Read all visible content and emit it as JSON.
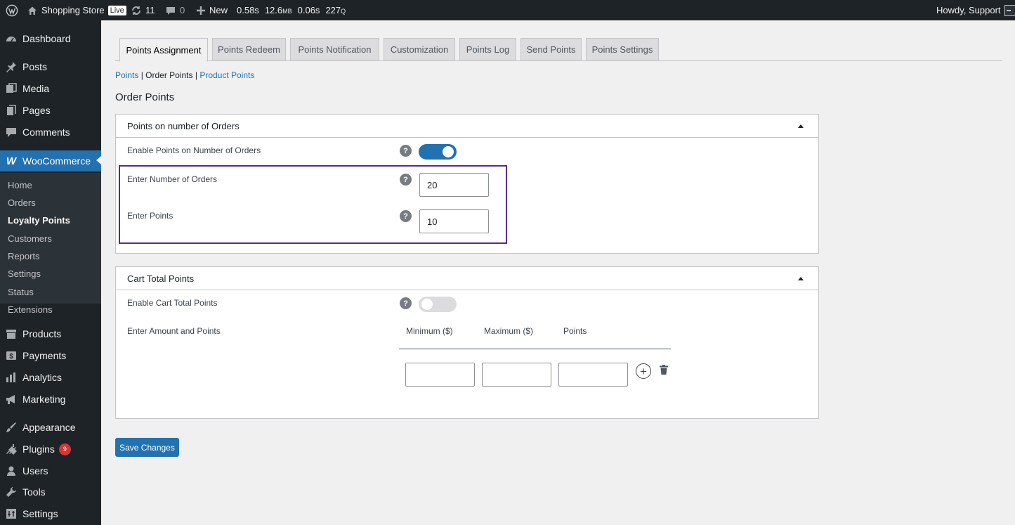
{
  "admin_bar": {
    "site_name": "Shopping Store",
    "live_badge": "Live",
    "updates_count": "11",
    "comments_count": "0",
    "new_label": "New",
    "perf_time": "0.58s",
    "perf_mem_value": "12.6",
    "perf_mem_unit": "MB",
    "perf_query_time": "0.06s",
    "perf_queries_value": "227",
    "perf_queries_unit": "Q",
    "greeting": "Howdy, Support"
  },
  "sidebar": {
    "dashboard": "Dashboard",
    "posts": "Posts",
    "media": "Media",
    "pages": "Pages",
    "comments": "Comments",
    "woocommerce": "WooCommerce",
    "submenu": [
      "Home",
      "Orders",
      "Loyalty Points",
      "Customers",
      "Reports",
      "Settings",
      "Status",
      "Extensions"
    ],
    "products": "Products",
    "payments": "Payments",
    "analytics": "Analytics",
    "marketing": "Marketing",
    "appearance": "Appearance",
    "plugins": "Plugins",
    "plugins_badge": "9",
    "users": "Users",
    "tools": "Tools",
    "settings": "Settings"
  },
  "tabs": [
    "Points Assignment",
    "Points Redeem",
    "Points Notification",
    "Customization",
    "Points Log",
    "Send Points",
    "Points Settings"
  ],
  "active_tab": "Points Assignment",
  "subnav": {
    "points": "Points",
    "sep1": " | ",
    "order_points": "Order Points",
    "sep2": " | ",
    "product_points": "Product Points"
  },
  "page_title": "Order Points",
  "orders_section": {
    "title": "Points on number of Orders",
    "enable_label": "Enable Points on Number of Orders",
    "enabled": true,
    "num_orders_label": "Enter Number of Orders",
    "num_orders_value": "20",
    "points_label": "Enter Points",
    "points_value": "10"
  },
  "cart_section": {
    "title": "Cart Total Points",
    "enable_label": "Enable Cart Total Points",
    "enabled": false,
    "amount_label": "Enter Amount and Points",
    "col_min": "Minimum ($)",
    "col_max": "Maximum ($)",
    "col_points": "Points"
  },
  "help_glyph": "?",
  "plus_glyph": "+",
  "save_label": "Save Changes",
  "colors": {
    "admin_bar": "#1d2327",
    "accent": "#2271b1",
    "highlight_border": "#5b2a86",
    "badge": "#d63638"
  }
}
